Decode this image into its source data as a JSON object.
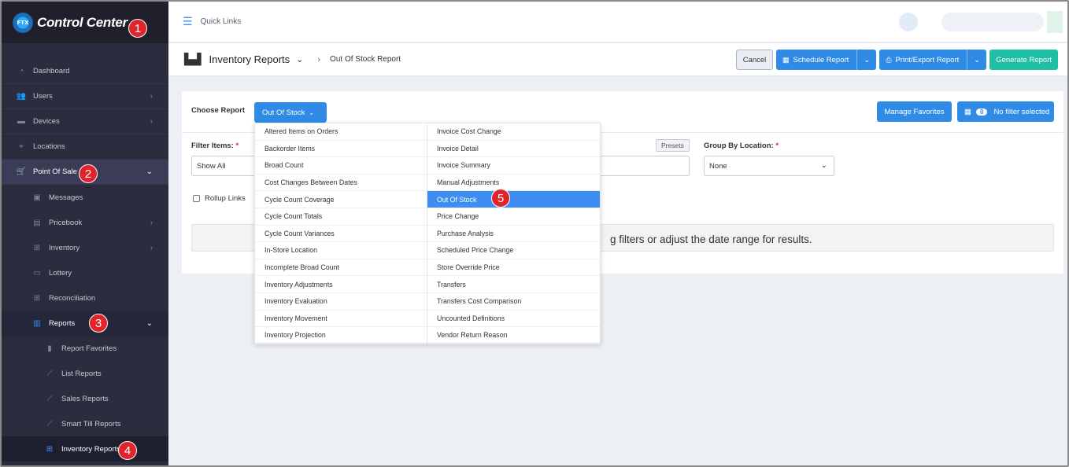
{
  "app": {
    "logo_text": "Control Center",
    "logo_mark": "FTX"
  },
  "topbar": {
    "quick_links": "Quick Links"
  },
  "sidebar": {
    "items": [
      {
        "label": "Dashboard",
        "icon": "dashboard-icon"
      },
      {
        "label": "Users",
        "icon": "users-icon"
      },
      {
        "label": "Devices",
        "icon": "devices-icon"
      },
      {
        "label": "Locations",
        "icon": "location-pin-icon"
      },
      {
        "label": "Point Of Sale",
        "icon": "cart-icon"
      },
      {
        "label": "Messages",
        "icon": "message-icon"
      },
      {
        "label": "Pricebook",
        "icon": "pricebook-icon"
      },
      {
        "label": "Inventory",
        "icon": "inventory-icon"
      },
      {
        "label": "Lottery",
        "icon": "lottery-icon"
      },
      {
        "label": "Reconciliation",
        "icon": "reconciliation-icon"
      },
      {
        "label": "Reports",
        "icon": "bar-chart-icon"
      },
      {
        "label": "Report Favorites",
        "icon": "bookmark-icon"
      },
      {
        "label": "List Reports",
        "icon": "line-chart-icon"
      },
      {
        "label": "Sales Reports",
        "icon": "line-chart-icon"
      },
      {
        "label": "Smart Till Reports",
        "icon": "line-chart-icon"
      },
      {
        "label": "Inventory Reports",
        "icon": "inventory-icon"
      }
    ]
  },
  "header": {
    "title": "Inventory Reports",
    "breadcrumb": "Out Of Stock Report",
    "cancel": "Cancel",
    "schedule": "Schedule Report",
    "print_export": "Print/Export Report",
    "generate": "Generate Report"
  },
  "card": {
    "choose_label": "Choose Report",
    "choose_value": "Out Of Stock",
    "manage_favorites": "Manage Favorites",
    "filter_count": "0",
    "no_filter": "No filter selected",
    "filter_items_label": "Filter Items:",
    "filter_items_value": "Show All",
    "required_mark": "*",
    "presets": "Presets",
    "group_by_label": "Group By Location:",
    "group_by_value": "None",
    "rollup": "Rollup Links",
    "message": "g filters or adjust the date range for results."
  },
  "dropdown": {
    "col1": [
      "Altered Items on Orders",
      "Backorder Items",
      "Broad Count",
      "Cost Changes Between Dates",
      "Cycle Count Coverage",
      "Cycle Count Totals",
      "Cycle Count Variances",
      "In-Store Location",
      "Incomplete Broad Count",
      "Inventory Adjustments",
      "Inventory Evaluation",
      "Inventory Movement",
      "Inventory Projection"
    ],
    "col2": [
      "Invoice Cost Change",
      "Invoice Detail",
      "Invoice Summary",
      "Manual Adjustments",
      "Out Of Stock",
      "Price Change",
      "Purchase Analysis",
      "Scheduled Price Change",
      "Store Override Price",
      "Transfers",
      "Transfers Cost Comparison",
      "Uncounted Definitions",
      "Vendor Return Reason"
    ],
    "selected": "Out Of Stock"
  },
  "badges": [
    "1",
    "2",
    "3",
    "4",
    "5"
  ],
  "colors": {
    "accent": "#2f8be6",
    "green": "#1fbfa6",
    "sidebar": "#2b2d3e",
    "badge": "#e0242b"
  }
}
